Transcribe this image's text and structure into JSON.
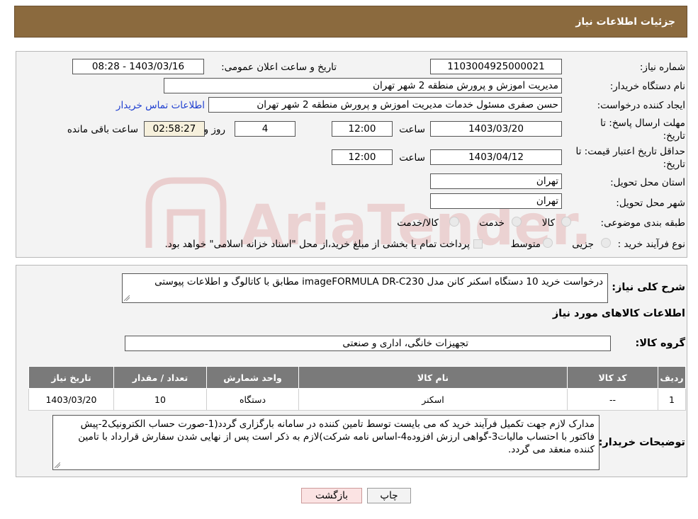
{
  "header": {
    "title": "جزئیات اطلاعات نیاز"
  },
  "form": {
    "need_number_label": "شماره نیاز:",
    "need_number": "1103004925000021",
    "announce_label": "تاریخ و ساعت اعلان عمومی:",
    "announce_value": "1403/03/16 - 08:28",
    "buyer_org_label": "نام دستگاه خریدار:",
    "buyer_org": "مدیریت اموزش و پرورش منطقه 2 شهر تهران",
    "requester_label": "ایجاد کننده درخواست:",
    "requester": "حسن صفری مسئول خدمات مدیریت اموزش و پرورش منطقه 2 شهر تهران",
    "contact_link": "اطلاعات تماس خریدار",
    "deadline_label_1": "مهلت ارسال پاسخ: تا",
    "deadline_label_2": "تاریخ:",
    "deadline_date": "1403/03/20",
    "time_label": "ساعت",
    "deadline_time": "12:00",
    "days_value": "4",
    "days_label": "روز و",
    "remaining_time": "02:58:27",
    "remaining_label": "ساعت باقی مانده",
    "validity_label_1": "حداقل تاریخ اعتبار قیمت: تا",
    "validity_label_2": "تاریخ:",
    "validity_date": "1403/04/12",
    "validity_time": "12:00",
    "province_label": "استان محل تحویل:",
    "province": "تهران",
    "city_label": "شهر محل تحویل:",
    "city": "تهران",
    "category_label": "طبقه بندی موضوعی:",
    "category_options": [
      "کالا",
      "خدمت",
      "کالا/خدمت"
    ],
    "process_label": "نوع فرآیند خرید :",
    "process_options": [
      "جزیی",
      "متوسط"
    ],
    "process_note": "پرداخت تمام یا بخشی از مبلغ خرید،از محل \"اسناد خزانه اسلامی\" خواهد بود."
  },
  "details": {
    "summary_label": "شرح کلی نیاز:",
    "summary": "درخواست خرید 10 دستگاه اسکنر کانن مدل imageFORMULA DR-C230 مطابق با کاتالوگ و اطلاعات پیوستی",
    "goods_info_title": "اطلاعات کالاهای مورد نیاز",
    "goods_group_label": "گروه کالا:",
    "goods_group": "تجهیزات خانگی، اداری و صنعتی"
  },
  "table": {
    "headers": [
      "ردیف",
      "کد کالا",
      "نام کالا",
      "واحد شمارش",
      "تعداد / مقدار",
      "تاریخ نیاز"
    ],
    "rows": [
      [
        "1",
        "--",
        "اسکنر",
        "دستگاه",
        "10",
        "1403/03/20"
      ]
    ]
  },
  "buyer_notes": {
    "label": "توضیحات خریدار:",
    "text": "مدارک لازم جهت تکمیل فرآیند خرید که می بایست توسط تامین کننده در سامانه بارگزاری گردد(1-صورت حساب الکترونیک2-پیش فاکتور با احتساب مالیات3-گواهی ارزش افزوده4-اساس نامه شرکت)لازم به ذکر است پس از نهایی شدن سفارش قرارداد با تامین کننده منعقد می گردد."
  },
  "buttons": {
    "print": "چاپ",
    "back": "بازگشت"
  },
  "colors": {
    "header_bg": "#8b6a3e",
    "table_header_bg": "#7a7a7a",
    "link": "#1f3fd0",
    "back_btn_bg": "#fbe3e3"
  },
  "watermark": {
    "text": "AriaTender.neT"
  }
}
